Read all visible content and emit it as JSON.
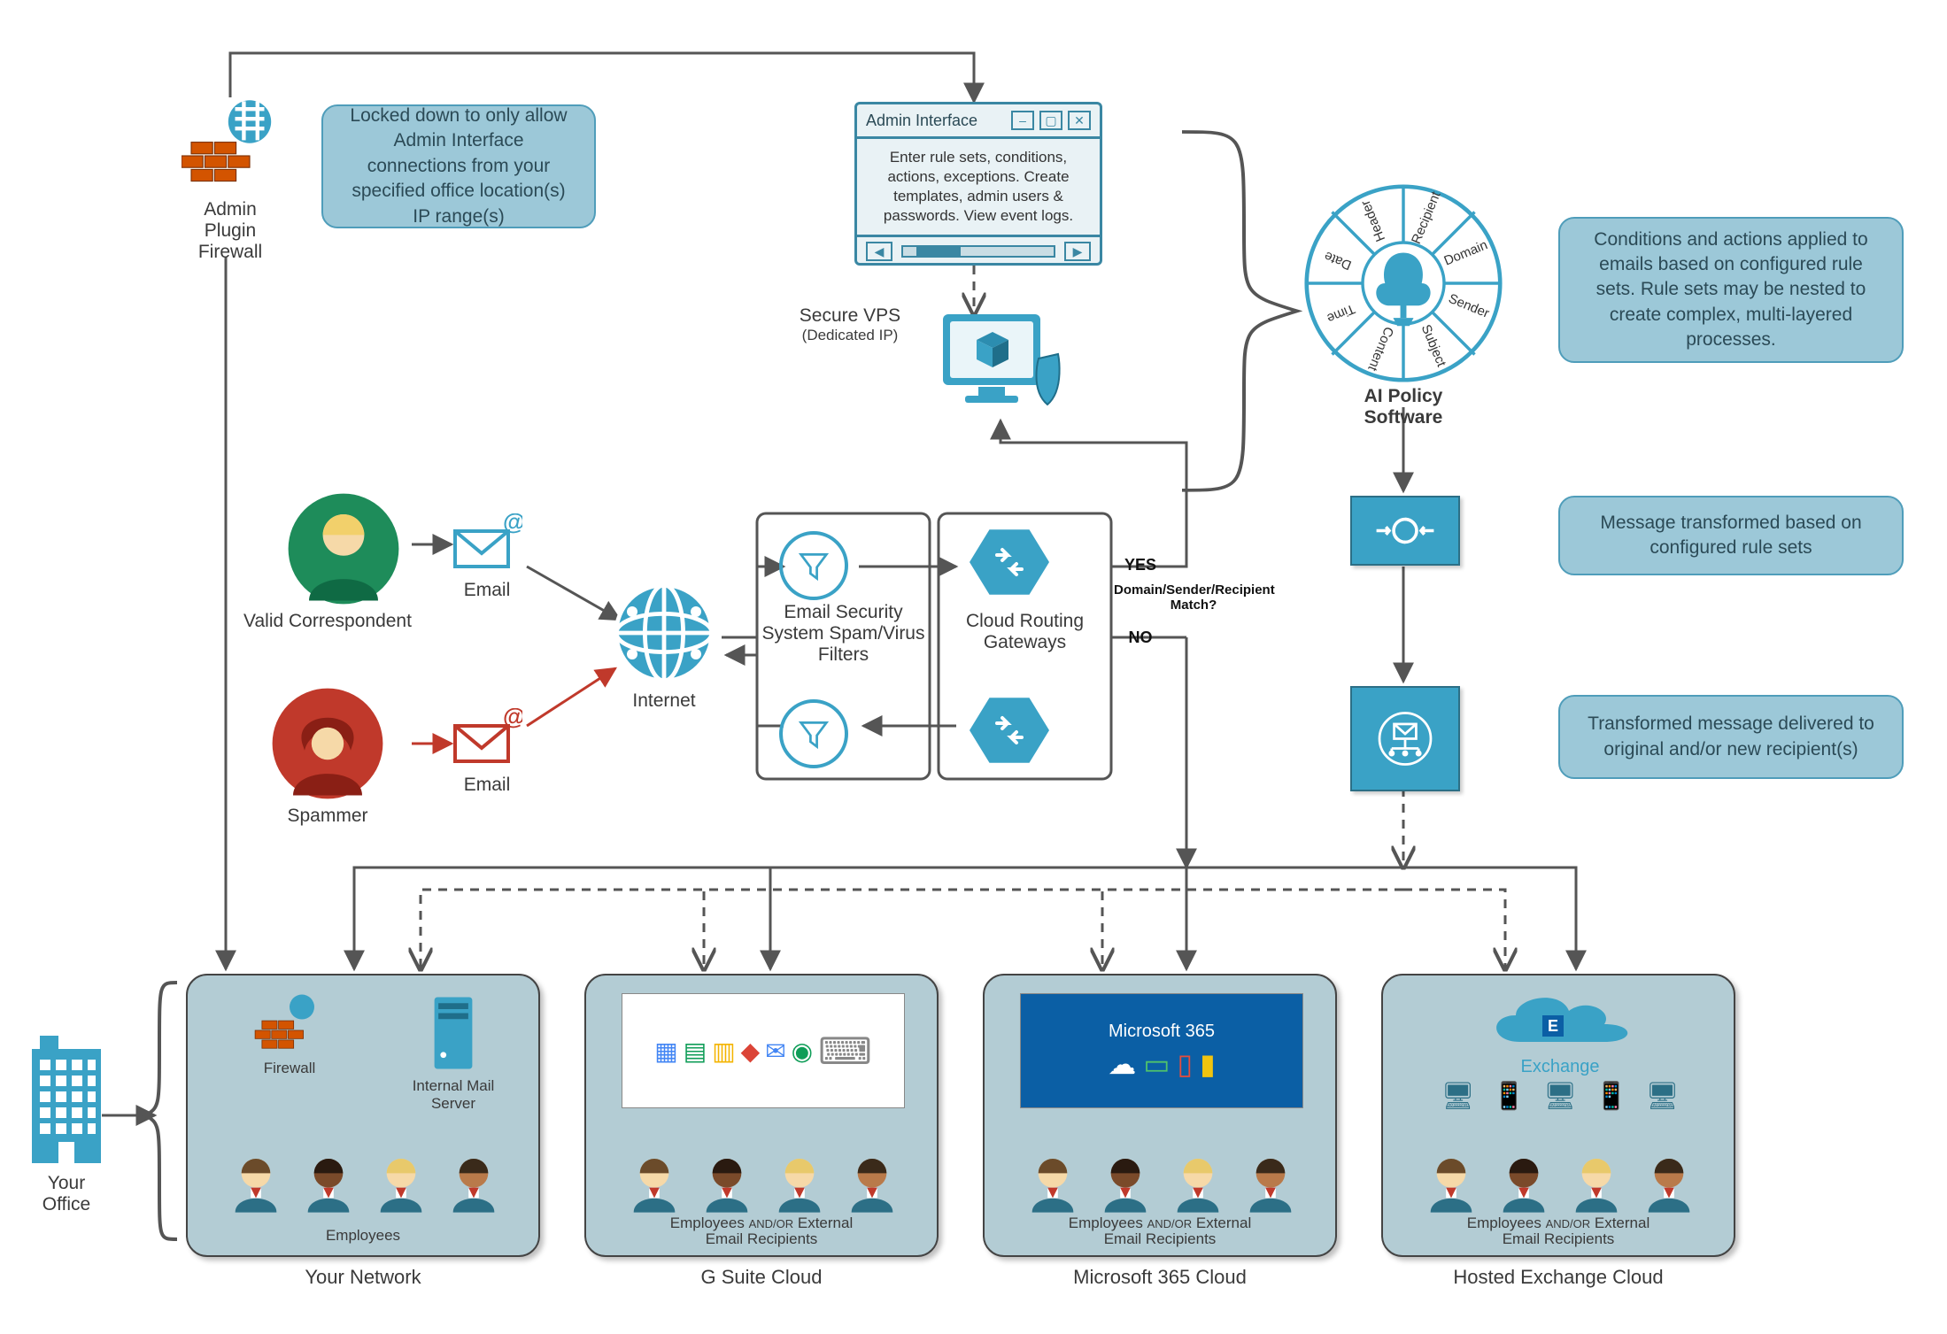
{
  "admin_plugin_firewall": {
    "label": "Admin Plugin\nFirewall"
  },
  "callouts": {
    "firewall_lock": "Locked down to only allow Admin Interface connections from your specified office location(s) IP range(s)",
    "ai_conditions": "Conditions and actions applied to emails based on configured rule sets.  Rule sets may be nested to create complex, multi-layered processes.",
    "transformed": "Message transformed based on configured rule sets",
    "delivered": "Transformed message delivered to original and/or new recipient(s)"
  },
  "admin_window": {
    "title": "Admin Interface",
    "body": "Enter rule sets, conditions, actions, exceptions.  Create templates, admin users & passwords.  View event logs."
  },
  "secure_vps": {
    "label": "Secure VPS",
    "sub": "(Dedicated IP)"
  },
  "correspondents": {
    "valid": "Valid Correspondent",
    "spammer": "Spammer",
    "email": "Email"
  },
  "internet": "Internet",
  "email_security": "Email Security System Spam/Virus Filters",
  "routing": "Cloud Routing Gateways",
  "decision": {
    "yes": "YES",
    "no": "NO",
    "question": "Domain/Sender/Recipient Match?"
  },
  "ai_policy": {
    "label": "AI Policy\nSoftware",
    "segments": [
      "Recipient",
      "Domain",
      "Sender",
      "Subject",
      "Content",
      "Time",
      "Date",
      "Header"
    ]
  },
  "office": {
    "label": "Your\nOffice"
  },
  "clouds": {
    "your_network": {
      "caption": "Your Network",
      "firewall": "Firewall",
      "mail_server": "Internal Mail Server",
      "employees": "Employees"
    },
    "gsuite": {
      "caption": "G Suite Cloud",
      "line1": "Employees",
      "andor": "AND/OR",
      "line2": "External",
      "line3": "Email Recipients"
    },
    "m365": {
      "caption": "Microsoft 365 Cloud",
      "line1": "Employees",
      "andor": "AND/OR",
      "line2": "External",
      "line3": "Email Recipients",
      "product": "Microsoft 365"
    },
    "exchange": {
      "caption": "Hosted Exchange Cloud",
      "line1": "Employees",
      "andor": "AND/OR",
      "line2": "External",
      "line3": "Email Recipients",
      "product": "Exchange"
    }
  },
  "colors": {
    "accent": "#3aa2c6",
    "accent_dark": "#2c6f86",
    "callout_bg": "#9cc8d8",
    "cloud_bg": "#b3ccd4",
    "red": "#c0392b",
    "green": "#1e8c5a",
    "m365_blue": "#0b5fa5"
  }
}
